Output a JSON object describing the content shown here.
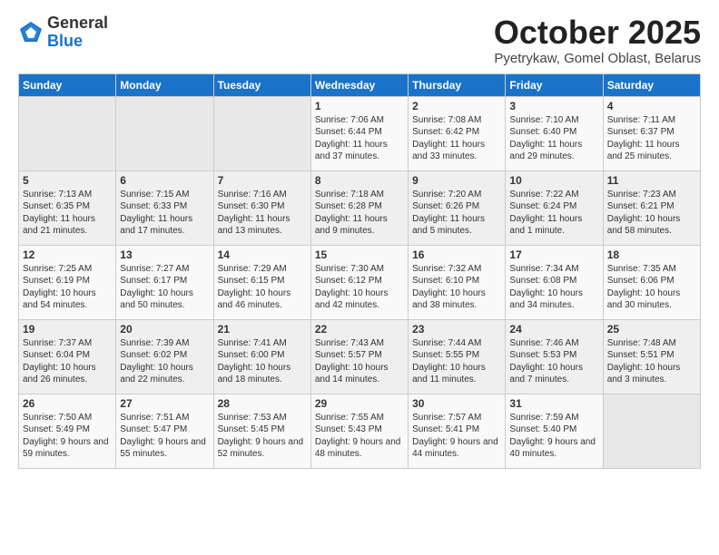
{
  "header": {
    "logo_general": "General",
    "logo_blue": "Blue",
    "month": "October 2025",
    "location": "Pyetrykaw, Gomel Oblast, Belarus"
  },
  "days_of_week": [
    "Sunday",
    "Monday",
    "Tuesday",
    "Wednesday",
    "Thursday",
    "Friday",
    "Saturday"
  ],
  "weeks": [
    [
      {
        "day": "",
        "content": ""
      },
      {
        "day": "",
        "content": ""
      },
      {
        "day": "",
        "content": ""
      },
      {
        "day": "1",
        "content": "Sunrise: 7:06 AM\nSunset: 6:44 PM\nDaylight: 11 hours\nand 37 minutes."
      },
      {
        "day": "2",
        "content": "Sunrise: 7:08 AM\nSunset: 6:42 PM\nDaylight: 11 hours\nand 33 minutes."
      },
      {
        "day": "3",
        "content": "Sunrise: 7:10 AM\nSunset: 6:40 PM\nDaylight: 11 hours\nand 29 minutes."
      },
      {
        "day": "4",
        "content": "Sunrise: 7:11 AM\nSunset: 6:37 PM\nDaylight: 11 hours\nand 25 minutes."
      }
    ],
    [
      {
        "day": "5",
        "content": "Sunrise: 7:13 AM\nSunset: 6:35 PM\nDaylight: 11 hours\nand 21 minutes."
      },
      {
        "day": "6",
        "content": "Sunrise: 7:15 AM\nSunset: 6:33 PM\nDaylight: 11 hours\nand 17 minutes."
      },
      {
        "day": "7",
        "content": "Sunrise: 7:16 AM\nSunset: 6:30 PM\nDaylight: 11 hours\nand 13 minutes."
      },
      {
        "day": "8",
        "content": "Sunrise: 7:18 AM\nSunset: 6:28 PM\nDaylight: 11 hours\nand 9 minutes."
      },
      {
        "day": "9",
        "content": "Sunrise: 7:20 AM\nSunset: 6:26 PM\nDaylight: 11 hours\nand 5 minutes."
      },
      {
        "day": "10",
        "content": "Sunrise: 7:22 AM\nSunset: 6:24 PM\nDaylight: 11 hours\nand 1 minute."
      },
      {
        "day": "11",
        "content": "Sunrise: 7:23 AM\nSunset: 6:21 PM\nDaylight: 10 hours\nand 58 minutes."
      }
    ],
    [
      {
        "day": "12",
        "content": "Sunrise: 7:25 AM\nSunset: 6:19 PM\nDaylight: 10 hours\nand 54 minutes."
      },
      {
        "day": "13",
        "content": "Sunrise: 7:27 AM\nSunset: 6:17 PM\nDaylight: 10 hours\nand 50 minutes."
      },
      {
        "day": "14",
        "content": "Sunrise: 7:29 AM\nSunset: 6:15 PM\nDaylight: 10 hours\nand 46 minutes."
      },
      {
        "day": "15",
        "content": "Sunrise: 7:30 AM\nSunset: 6:12 PM\nDaylight: 10 hours\nand 42 minutes."
      },
      {
        "day": "16",
        "content": "Sunrise: 7:32 AM\nSunset: 6:10 PM\nDaylight: 10 hours\nand 38 minutes."
      },
      {
        "day": "17",
        "content": "Sunrise: 7:34 AM\nSunset: 6:08 PM\nDaylight: 10 hours\nand 34 minutes."
      },
      {
        "day": "18",
        "content": "Sunrise: 7:35 AM\nSunset: 6:06 PM\nDaylight: 10 hours\nand 30 minutes."
      }
    ],
    [
      {
        "day": "19",
        "content": "Sunrise: 7:37 AM\nSunset: 6:04 PM\nDaylight: 10 hours\nand 26 minutes."
      },
      {
        "day": "20",
        "content": "Sunrise: 7:39 AM\nSunset: 6:02 PM\nDaylight: 10 hours\nand 22 minutes."
      },
      {
        "day": "21",
        "content": "Sunrise: 7:41 AM\nSunset: 6:00 PM\nDaylight: 10 hours\nand 18 minutes."
      },
      {
        "day": "22",
        "content": "Sunrise: 7:43 AM\nSunset: 5:57 PM\nDaylight: 10 hours\nand 14 minutes."
      },
      {
        "day": "23",
        "content": "Sunrise: 7:44 AM\nSunset: 5:55 PM\nDaylight: 10 hours\nand 11 minutes."
      },
      {
        "day": "24",
        "content": "Sunrise: 7:46 AM\nSunset: 5:53 PM\nDaylight: 10 hours\nand 7 minutes."
      },
      {
        "day": "25",
        "content": "Sunrise: 7:48 AM\nSunset: 5:51 PM\nDaylight: 10 hours\nand 3 minutes."
      }
    ],
    [
      {
        "day": "26",
        "content": "Sunrise: 7:50 AM\nSunset: 5:49 PM\nDaylight: 9 hours\nand 59 minutes."
      },
      {
        "day": "27",
        "content": "Sunrise: 7:51 AM\nSunset: 5:47 PM\nDaylight: 9 hours\nand 55 minutes."
      },
      {
        "day": "28",
        "content": "Sunrise: 7:53 AM\nSunset: 5:45 PM\nDaylight: 9 hours\nand 52 minutes."
      },
      {
        "day": "29",
        "content": "Sunrise: 7:55 AM\nSunset: 5:43 PM\nDaylight: 9 hours\nand 48 minutes."
      },
      {
        "day": "30",
        "content": "Sunrise: 7:57 AM\nSunset: 5:41 PM\nDaylight: 9 hours\nand 44 minutes."
      },
      {
        "day": "31",
        "content": "Sunrise: 7:59 AM\nSunset: 5:40 PM\nDaylight: 9 hours\nand 40 minutes."
      },
      {
        "day": "",
        "content": ""
      }
    ]
  ]
}
